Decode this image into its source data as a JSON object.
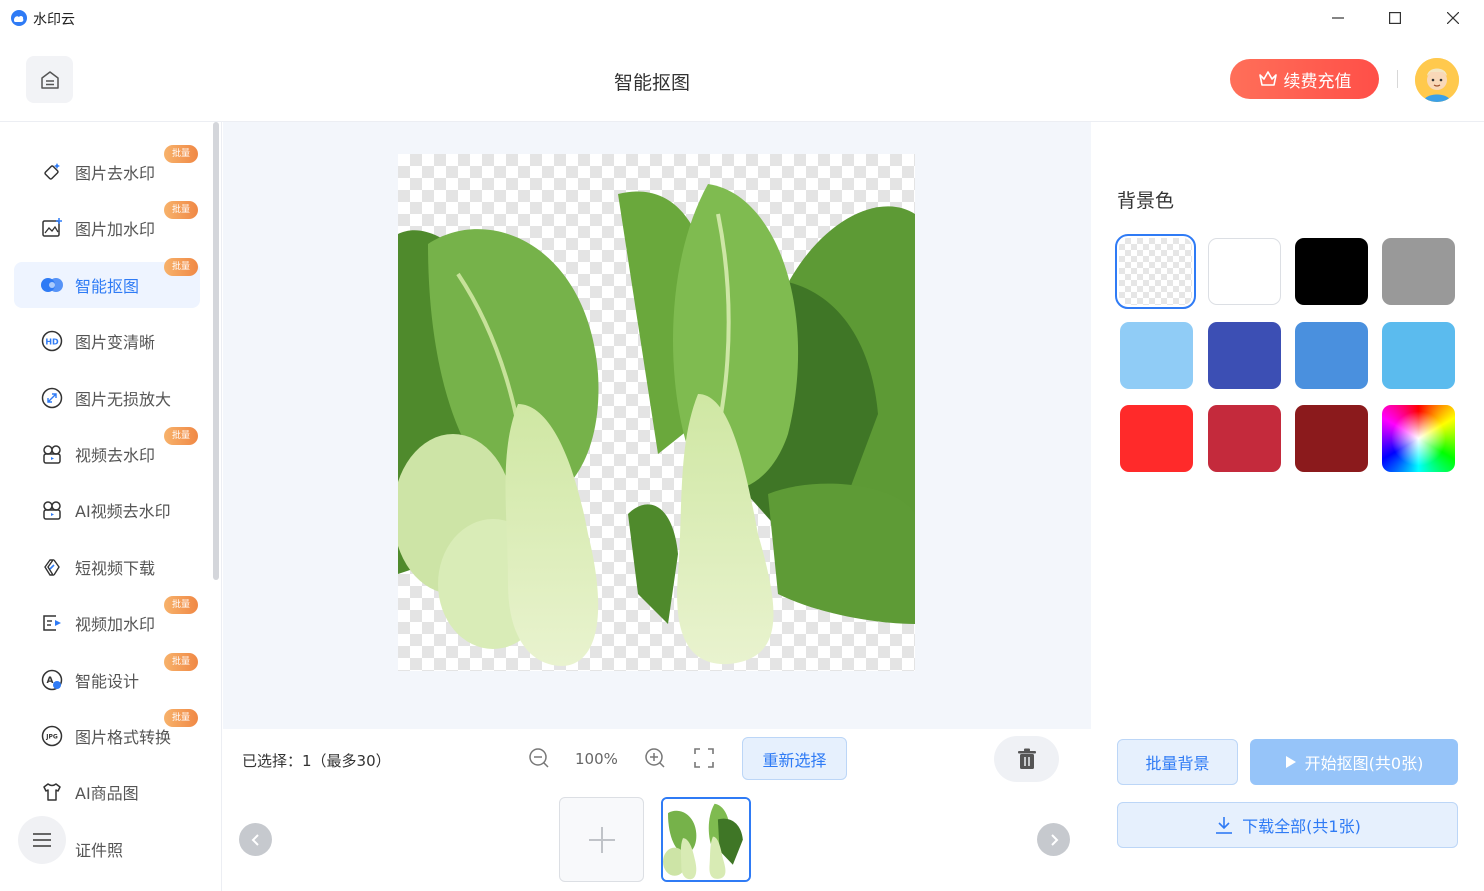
{
  "app": {
    "title": "水印云"
  },
  "header": {
    "page_title": "智能抠图",
    "recharge_label": "续费充值"
  },
  "sidebar": {
    "items": [
      {
        "label": "图片去水印",
        "icon": "eraser-icon",
        "badge": "批量",
        "active": false
      },
      {
        "label": "图片加水印",
        "icon": "image-add-icon",
        "badge": "批量",
        "active": false
      },
      {
        "label": "智能抠图",
        "icon": "cutout-icon",
        "badge": "批量",
        "active": true
      },
      {
        "label": "图片变清晰",
        "icon": "hd-icon",
        "badge": "",
        "active": false
      },
      {
        "label": "图片无损放大",
        "icon": "enlarge-icon",
        "badge": "",
        "active": false
      },
      {
        "label": "视频去水印",
        "icon": "video-eraser-icon",
        "badge": "批量",
        "active": false
      },
      {
        "label": "AI视频去水印",
        "icon": "ai-video-eraser-icon",
        "badge": "",
        "active": false
      },
      {
        "label": "短视频下载",
        "icon": "link-icon",
        "badge": "",
        "active": false
      },
      {
        "label": "视频加水印",
        "icon": "video-add-icon",
        "badge": "批量",
        "active": false
      },
      {
        "label": "智能设计",
        "icon": "design-icon",
        "badge": "批量",
        "active": false
      },
      {
        "label": "图片格式转换",
        "icon": "jpg-icon",
        "badge": "批量",
        "active": false
      },
      {
        "label": "AI商品图",
        "icon": "shirt-icon",
        "badge": "",
        "active": false
      },
      {
        "label": "证件照",
        "icon": "id-photo-icon",
        "badge": "",
        "active": false
      }
    ]
  },
  "toolbar": {
    "selection_info": "已选择：1（最多30）",
    "zoom": "100%",
    "reselect_label": "重新选择"
  },
  "right_panel": {
    "bg_title": "背景色",
    "swatches": [
      {
        "name": "transparent",
        "color": "transparent"
      },
      {
        "name": "white",
        "color": "#ffffff"
      },
      {
        "name": "black",
        "color": "#000000"
      },
      {
        "name": "gray",
        "color": "#999999"
      },
      {
        "name": "light-blue",
        "color": "#90ccf6"
      },
      {
        "name": "indigo",
        "color": "#3c4fb4"
      },
      {
        "name": "blue",
        "color": "#4a90de"
      },
      {
        "name": "sky-blue",
        "color": "#5bbbee"
      },
      {
        "name": "red",
        "color": "#ff2a2a"
      },
      {
        "name": "crimson",
        "color": "#c42a3c"
      },
      {
        "name": "dark-red",
        "color": "#8b1a1c"
      },
      {
        "name": "color-picker",
        "color": "rainbow"
      }
    ],
    "selected_swatch": 0,
    "batch_bg_label": "批量背景",
    "start_label": "开始抠图(共0张)",
    "download_label": "下载全部(共1张)"
  },
  "colors": {
    "accent": "#2f7bf5",
    "recharge": "#ff5a4f",
    "badge": "#f08845"
  }
}
